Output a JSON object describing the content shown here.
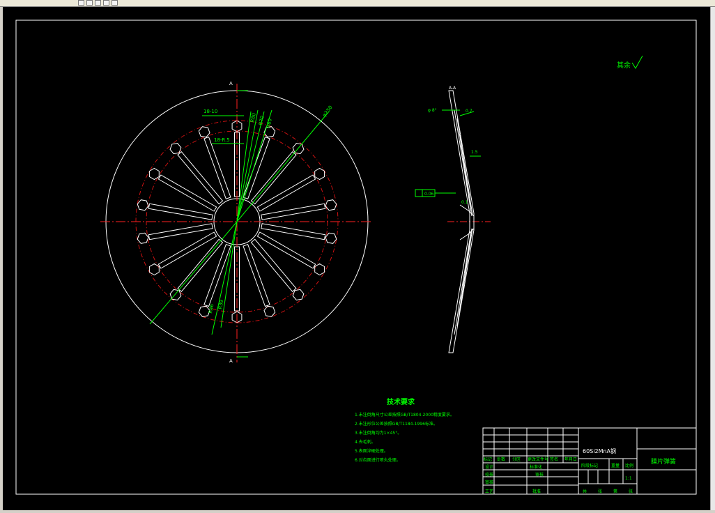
{
  "window": {
    "toolbar_icons": [
      "new-icon",
      "open-icon",
      "save-icon",
      "print-icon",
      "close-icon"
    ]
  },
  "drawing": {
    "roughness_note": "其余",
    "front_view": {
      "section_marks": [
        "A",
        "A"
      ],
      "dims": [
        "18-10",
        "18-R.5",
        "R80",
        "R70",
        "R60",
        "R46",
        "R39",
        "φ250"
      ]
    },
    "side_view": {
      "section_title": "A-A",
      "dims": [
        "φ 8°",
        "0.7",
        "1.5",
        "0.1",
        "0.06"
      ]
    },
    "tech_requirements": {
      "title": "技术要求",
      "items": [
        "1.未注倒角尺寸公差按照GB/T1804-2000精度要求。",
        "2.未注形位公差按照GB/T1184-1996标准。",
        "3.未注倒角均为1×45°。",
        "4.去毛刺。",
        "5.表面淬硬处理。",
        "6.对齿面进行喷丸处理。"
      ]
    },
    "title_block": {
      "material": "60Si2MnA钢",
      "part_name": "膜片弹簧",
      "row_labels": [
        "标记",
        "处数",
        "分区",
        "更改文件号",
        "签名",
        "年月日"
      ],
      "design": "设计",
      "standardize": "标准化",
      "check": "校核",
      "review": "审核",
      "process": "工艺",
      "approve": "批准",
      "stage_mark": "阶段标记",
      "weight": "重量",
      "scale": "比例",
      "scale_value": "1:1",
      "sheets": [
        "共",
        "张",
        "第",
        "张"
      ]
    }
  },
  "colors": {
    "background": "#000000",
    "outline": "#ffffff",
    "center_line": "#ff2020",
    "dimension": "#00ff00",
    "hidden_circle": "#cc1111",
    "text_primary": "#00ff00",
    "text_secondary": "#ffffff"
  }
}
